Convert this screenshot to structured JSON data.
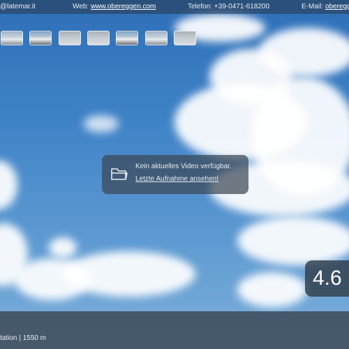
{
  "topbar": {
    "email_text": "@latemar.it",
    "web_label": "Web:",
    "web_link": "www.obereggen.com",
    "phone_text": "Telefon: +39-0471-618200",
    "email_label": "E-Mail:",
    "email_link": "obereggen"
  },
  "thumbnails": [
    {
      "name": "webcam-thumb-1"
    },
    {
      "name": "webcam-thumb-2"
    },
    {
      "name": "webcam-thumb-3"
    },
    {
      "name": "webcam-thumb-4"
    },
    {
      "name": "webcam-thumb-5"
    },
    {
      "name": "webcam-thumb-6"
    },
    {
      "name": "webcam-thumb-7"
    }
  ],
  "notice": {
    "icon": "folder-icon",
    "message": "Kein aktuelles Video verfügbar.",
    "link": "Letzte Aufnahme ansehen!"
  },
  "temperature": {
    "value": "4.6"
  },
  "footer": {
    "station": "tation | 1550 m"
  },
  "colors": {
    "overlay": "#3c4856",
    "sky": "#3f83c7"
  }
}
